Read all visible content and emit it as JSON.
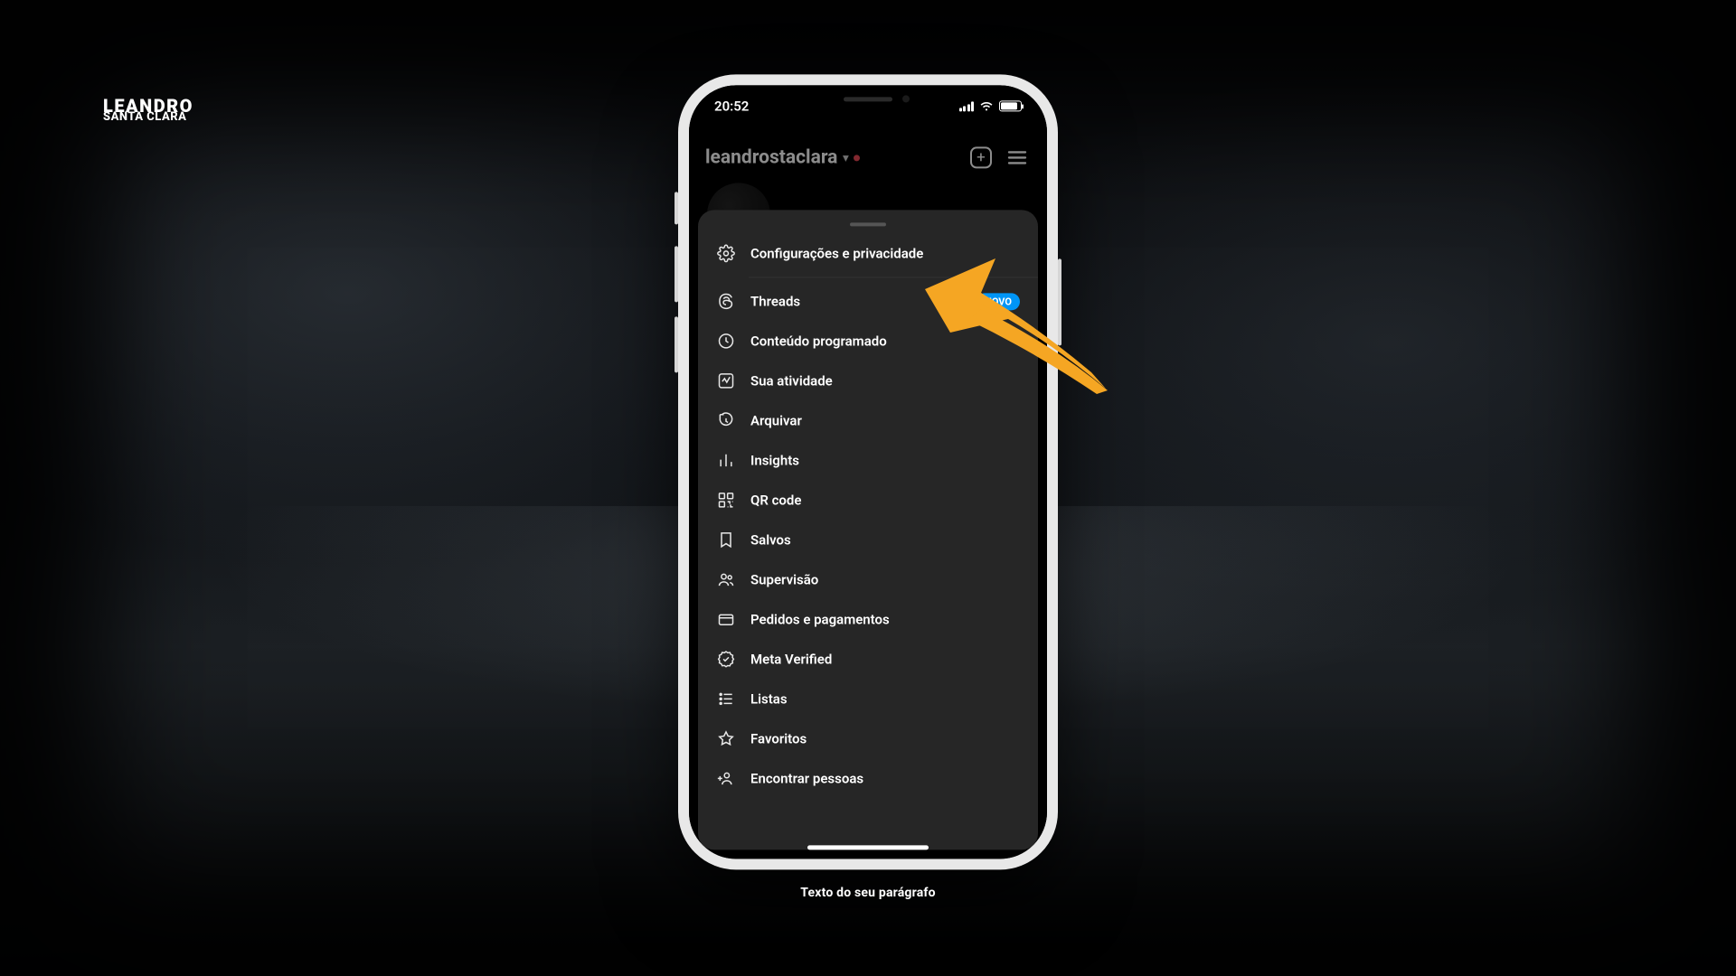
{
  "brand": {
    "line1": "LEANDRO",
    "line2": "santa clara"
  },
  "statusbar": {
    "time": "20:52"
  },
  "header": {
    "username": "leandrostaclara"
  },
  "menu": {
    "items": [
      {
        "icon": "settings",
        "label": "Configurações e privacidade"
      },
      {
        "icon": "threads",
        "label": "Threads",
        "badge": "NOVO"
      },
      {
        "icon": "clock",
        "label": "Conteúdo programado"
      },
      {
        "icon": "activity",
        "label": "Sua atividade"
      },
      {
        "icon": "archive",
        "label": "Arquivar"
      },
      {
        "icon": "insights",
        "label": "Insights"
      },
      {
        "icon": "qr",
        "label": "QR code"
      },
      {
        "icon": "bookmark",
        "label": "Salvos"
      },
      {
        "icon": "supervise",
        "label": "Supervisão"
      },
      {
        "icon": "card",
        "label": "Pedidos e pagamentos"
      },
      {
        "icon": "verified",
        "label": "Meta Verified"
      },
      {
        "icon": "list",
        "label": "Listas"
      },
      {
        "icon": "star",
        "label": "Favoritos"
      },
      {
        "icon": "addperson",
        "label": "Encontrar pessoas"
      }
    ]
  },
  "caption": "Texto do seu parágrafo",
  "colors": {
    "accent": "#0095f6",
    "arrow": "#f5a623"
  }
}
